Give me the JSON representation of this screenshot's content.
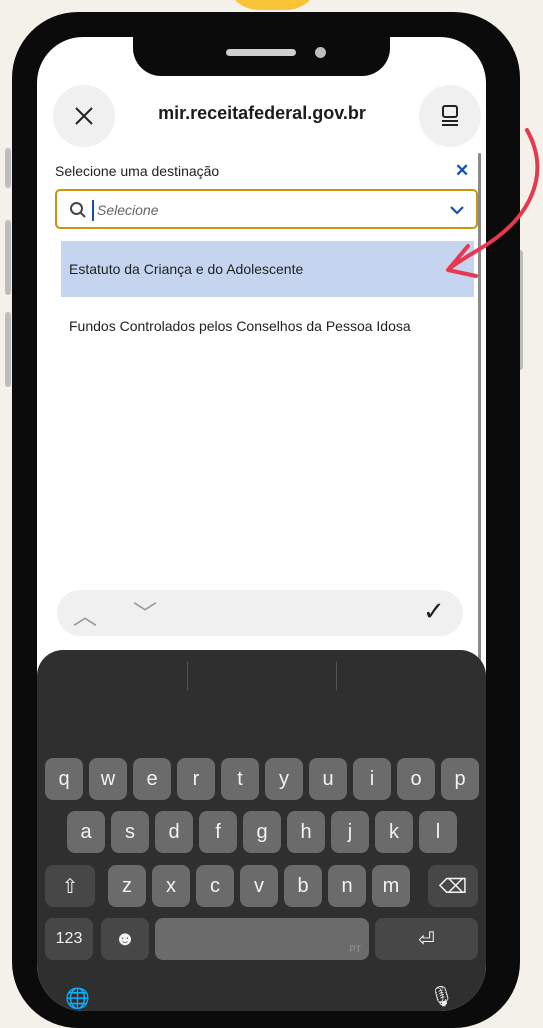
{
  "browser": {
    "url": "mir.receitafederal.gov.br",
    "close_icon": "close-icon",
    "reader_icon": "reader-mode-icon"
  },
  "form": {
    "label": "Selecione uma destinação",
    "clear_symbol": "✕",
    "search_placeholder": "Selecione",
    "options": [
      {
        "label": "Estatuto da Criança e do Adolescente",
        "selected": true
      },
      {
        "label": "Fundos Controlados pelos Conselhos da Pessoa Idosa",
        "selected": false
      }
    ]
  },
  "accessory_bar": {
    "prev_symbol": "︿",
    "next_symbol": "﹀",
    "done_symbol": "✓"
  },
  "keyboard": {
    "row1": [
      "q",
      "w",
      "e",
      "r",
      "t",
      "y",
      "u",
      "i",
      "o",
      "p"
    ],
    "row2": [
      "a",
      "s",
      "d",
      "f",
      "g",
      "h",
      "j",
      "k",
      "l"
    ],
    "row3": [
      "z",
      "x",
      "c",
      "v",
      "b",
      "n",
      "m"
    ],
    "numbers_key": "123",
    "emoji_symbol": "☻",
    "space_hint": "PT",
    "return_symbol": "⏎",
    "shift_symbol": "⇧",
    "delete_symbol": "⌫",
    "globe_symbol": "🌐",
    "mic_symbol": "🎙"
  },
  "colors": {
    "selected_option_bg": "#c5d5f0",
    "field_border": "#c8960c",
    "accent_blue": "#1351b4",
    "annotation_arrow": "#e8374f"
  }
}
